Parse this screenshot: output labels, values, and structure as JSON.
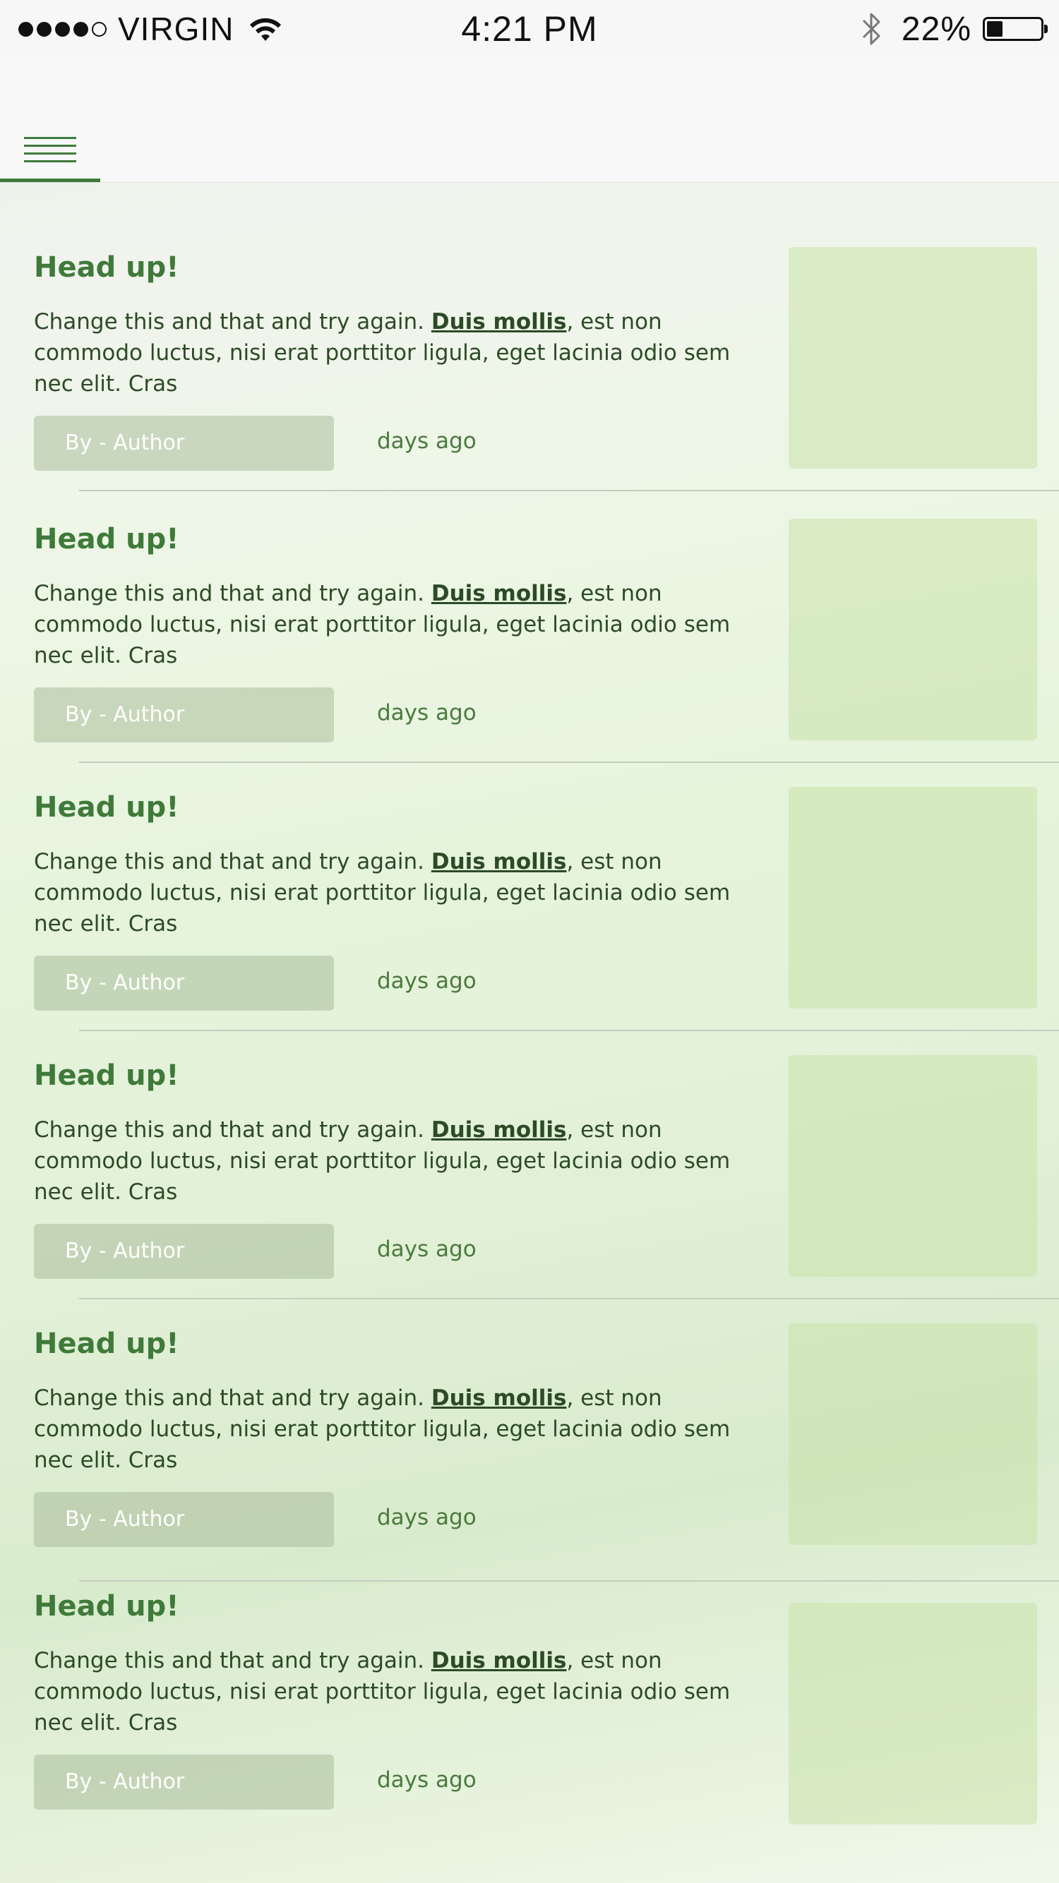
{
  "status_bar": {
    "carrier": "VIRGIN",
    "time": "4:21 PM",
    "battery_percent": "22%",
    "signal_bars_filled": 4,
    "signal_bars_total": 5,
    "battery_level": 0.22,
    "icons": [
      "signal-dots-icon",
      "wifi-icon",
      "bluetooth-icon",
      "battery-icon"
    ]
  },
  "nav": {
    "menu_icon": "hamburger-menu-icon",
    "accent_color": "#3e7a38"
  },
  "articles": [
    {
      "title": "Head up!",
      "text_before": "Change this and that and try again. ",
      "link": "Duis mollis",
      "text_after": ", est non commodo luctus, nisi erat porttitor ligula, eget lacinia odio sem nec elit. Cras",
      "author": "By - Author",
      "date": "days ago"
    },
    {
      "title": "Head up!",
      "text_before": "Change this and that and try again. ",
      "link": "Duis mollis",
      "text_after": ", est non commodo luctus, nisi erat porttitor ligula, eget lacinia odio sem nec elit. Cras",
      "author": "By - Author",
      "date": "days ago"
    },
    {
      "title": "Head up!",
      "text_before": "Change this and that and try again. ",
      "link": "Duis mollis",
      "text_after": ", est non commodo luctus, nisi erat porttitor ligula, eget lacinia odio sem nec elit. Cras",
      "author": "By - Author",
      "date": "days ago"
    },
    {
      "title": "Head up!",
      "text_before": "Change this and that and try again. ",
      "link": "Duis mollis",
      "text_after": ", est non commodo luctus, nisi erat porttitor ligula, eget lacinia odio sem nec elit. Cras",
      "author": "By - Author",
      "date": "days ago"
    },
    {
      "title": "Head up!",
      "text_before": "Change this and that and try again. ",
      "link": "Duis mollis",
      "text_after": ", est non commodo luctus, nisi erat porttitor ligula, eget lacinia odio sem nec elit. Cras",
      "author": "By - Author",
      "date": "days ago"
    },
    {
      "title": "Head up!",
      "text_before": "Change this and that and try again. ",
      "link": "Duis mollis",
      "text_after": ", est non commodo luctus, nisi erat porttitor ligula, eget lacinia odio sem nec elit. Cras",
      "author": "By - Author",
      "date": "days ago"
    }
  ],
  "colors": {
    "title": "#3f7a3a",
    "body_text": "#2d4a26",
    "date_text": "#4a7a3d"
  }
}
